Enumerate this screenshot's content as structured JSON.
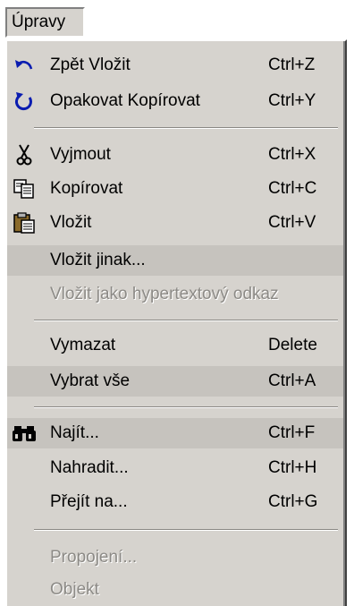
{
  "menu": {
    "title": "Úpravy"
  },
  "items": [
    {
      "label": "Zpět Vložit",
      "shortcut": "Ctrl+Z"
    },
    {
      "label": "Opakovat Kopírovat",
      "shortcut": "Ctrl+Y"
    },
    {
      "label": "Vyjmout",
      "shortcut": "Ctrl+X"
    },
    {
      "label": "Kopírovat",
      "shortcut": "Ctrl+C"
    },
    {
      "label": "Vložit",
      "shortcut": "Ctrl+V"
    },
    {
      "label": "Vložit jinak...",
      "shortcut": ""
    },
    {
      "label": "Vložit jako hypertextový odkaz",
      "shortcut": ""
    },
    {
      "label": "Vymazat",
      "shortcut": "Delete"
    },
    {
      "label": "Vybrat vše",
      "shortcut": "Ctrl+A"
    },
    {
      "label": "Najít...",
      "shortcut": "Ctrl+F"
    },
    {
      "label": "Nahradit...",
      "shortcut": "Ctrl+H"
    },
    {
      "label": "Přejít na...",
      "shortcut": "Ctrl+G"
    },
    {
      "label": "Propojení...",
      "shortcut": ""
    },
    {
      "label": "Objekt",
      "shortcut": ""
    }
  ],
  "icons": {
    "undo": "undo-arrow-icon",
    "redo": "redo-circular-arrow-icon",
    "cut": "scissors-icon",
    "copy": "copy-pages-icon",
    "paste": "clipboard-icon",
    "find": "binoculars-icon"
  },
  "colors": {
    "menu_face": "#d6d3ce",
    "highlight": "#c6c3be",
    "icon_blue": "#0a1cb0",
    "disabled_text": "#8c8a86"
  }
}
